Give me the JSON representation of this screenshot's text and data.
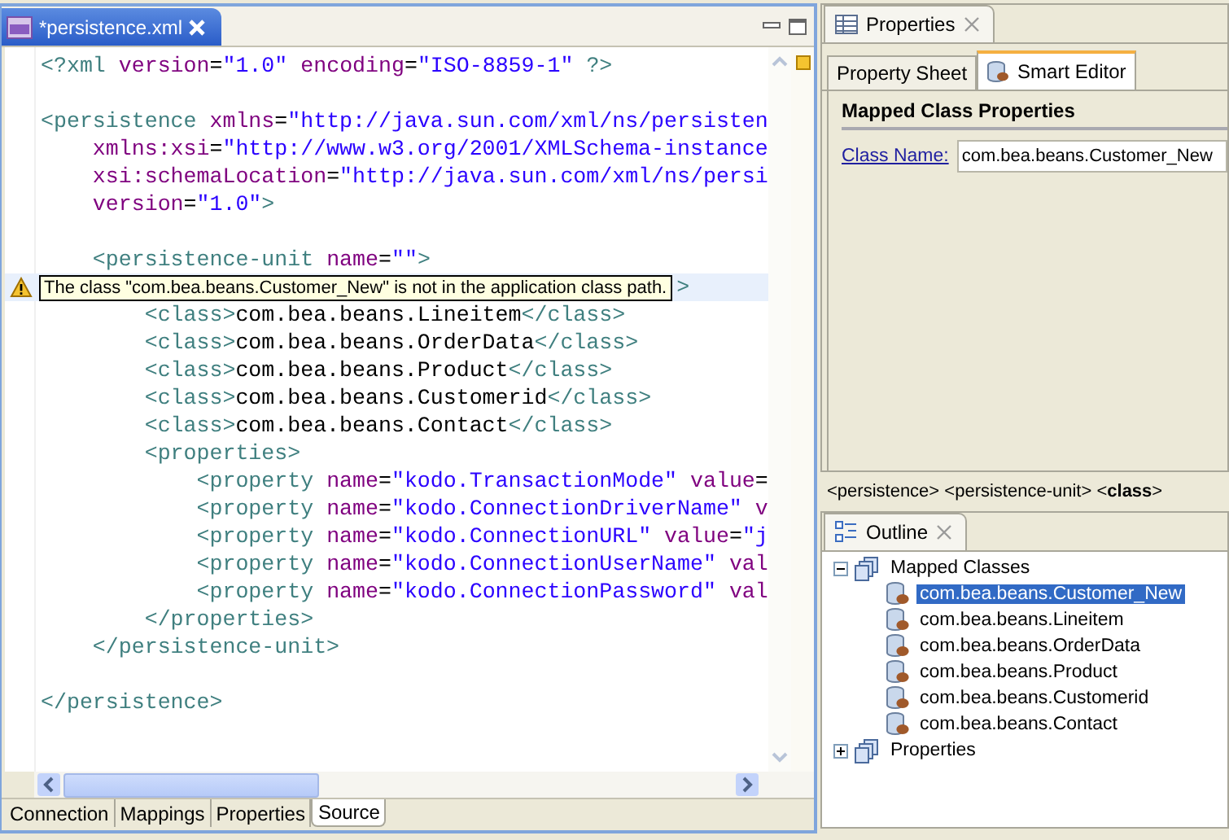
{
  "editor": {
    "tab": {
      "title": "*persistence.xml"
    },
    "lines": [
      {
        "kind": "code",
        "tokens": [
          {
            "kind": "tag",
            "t": "<?xml "
          },
          {
            "kind": "attr",
            "t": "version"
          },
          {
            "kind": "text",
            "t": "="
          },
          {
            "kind": "value",
            "t": "\"1.0\" "
          },
          {
            "kind": "attr",
            "t": "encoding"
          },
          {
            "kind": "text",
            "t": "="
          },
          {
            "kind": "value",
            "t": "\"ISO-8859-1\" "
          },
          {
            "kind": "tag",
            "t": "?>"
          }
        ]
      },
      {
        "kind": "blank"
      },
      {
        "kind": "code",
        "tokens": [
          {
            "kind": "tag",
            "t": "<persistence "
          },
          {
            "kind": "attr",
            "t": "xmlns"
          },
          {
            "kind": "text",
            "t": "="
          },
          {
            "kind": "value",
            "t": "\"http://java.sun.com/xml/ns/persisten"
          }
        ]
      },
      {
        "kind": "code",
        "tokens": [
          {
            "kind": "attr",
            "t": "    xmlns:xsi"
          },
          {
            "kind": "text",
            "t": "="
          },
          {
            "kind": "value",
            "t": "\"http://www.w3.org/2001/XMLSchema-instance"
          }
        ]
      },
      {
        "kind": "code",
        "tokens": [
          {
            "kind": "attr",
            "t": "    xsi:schemaLocation"
          },
          {
            "kind": "text",
            "t": "="
          },
          {
            "kind": "value",
            "t": "\"http://java.sun.com/xml/ns/persi"
          }
        ]
      },
      {
        "kind": "code",
        "tokens": [
          {
            "kind": "attr",
            "t": "    version"
          },
          {
            "kind": "text",
            "t": "="
          },
          {
            "kind": "value",
            "t": "\"1.0\""
          },
          {
            "kind": "tag",
            "t": ">"
          }
        ]
      },
      {
        "kind": "blank"
      },
      {
        "kind": "code",
        "tokens": [
          {
            "kind": "tag",
            "t": "    <persistence-unit "
          },
          {
            "kind": "attr",
            "t": "name"
          },
          {
            "kind": "text",
            "t": "="
          },
          {
            "kind": "value",
            "t": "\"\""
          },
          {
            "kind": "tag",
            "t": ">"
          }
        ]
      },
      {
        "kind": "warning",
        "tooltip": "The class \"com.bea.beans.Customer_New\" is not in the application class path.",
        "tokens": [
          {
            "kind": "tag",
            "t": ">"
          }
        ]
      },
      {
        "kind": "code",
        "tokens": [
          {
            "kind": "tag",
            "t": "        <class>"
          },
          {
            "kind": "text",
            "t": "com.bea.beans.Lineitem"
          },
          {
            "kind": "tag",
            "t": "</class>"
          }
        ]
      },
      {
        "kind": "code",
        "tokens": [
          {
            "kind": "tag",
            "t": "        <class>"
          },
          {
            "kind": "text",
            "t": "com.bea.beans.OrderData"
          },
          {
            "kind": "tag",
            "t": "</class>"
          }
        ]
      },
      {
        "kind": "code",
        "tokens": [
          {
            "kind": "tag",
            "t": "        <class>"
          },
          {
            "kind": "text",
            "t": "com.bea.beans.Product"
          },
          {
            "kind": "tag",
            "t": "</class>"
          }
        ]
      },
      {
        "kind": "code",
        "tokens": [
          {
            "kind": "tag",
            "t": "        <class>"
          },
          {
            "kind": "text",
            "t": "com.bea.beans.Customerid"
          },
          {
            "kind": "tag",
            "t": "</class>"
          }
        ]
      },
      {
        "kind": "code",
        "tokens": [
          {
            "kind": "tag",
            "t": "        <class>"
          },
          {
            "kind": "text",
            "t": "com.bea.beans.Contact"
          },
          {
            "kind": "tag",
            "t": "</class>"
          }
        ]
      },
      {
        "kind": "code",
        "tokens": [
          {
            "kind": "tag",
            "t": "        <properties>"
          }
        ]
      },
      {
        "kind": "code",
        "tokens": [
          {
            "kind": "tag",
            "t": "            <property "
          },
          {
            "kind": "attr",
            "t": "name"
          },
          {
            "kind": "text",
            "t": "="
          },
          {
            "kind": "value",
            "t": "\"kodo.TransactionMode\" "
          },
          {
            "kind": "attr",
            "t": "value"
          },
          {
            "kind": "text",
            "t": "="
          }
        ]
      },
      {
        "kind": "code",
        "tokens": [
          {
            "kind": "tag",
            "t": "            <property "
          },
          {
            "kind": "attr",
            "t": "name"
          },
          {
            "kind": "text",
            "t": "="
          },
          {
            "kind": "value",
            "t": "\"kodo.ConnectionDriverName\" "
          },
          {
            "kind": "attr",
            "t": "v"
          }
        ]
      },
      {
        "kind": "code",
        "tokens": [
          {
            "kind": "tag",
            "t": "            <property "
          },
          {
            "kind": "attr",
            "t": "name"
          },
          {
            "kind": "text",
            "t": "="
          },
          {
            "kind": "value",
            "t": "\"kodo.ConnectionURL\" "
          },
          {
            "kind": "attr",
            "t": "value"
          },
          {
            "kind": "text",
            "t": "="
          },
          {
            "kind": "value",
            "t": "\"j"
          }
        ]
      },
      {
        "kind": "code",
        "tokens": [
          {
            "kind": "tag",
            "t": "            <property "
          },
          {
            "kind": "attr",
            "t": "name"
          },
          {
            "kind": "text",
            "t": "="
          },
          {
            "kind": "value",
            "t": "\"kodo.ConnectionUserName\" "
          },
          {
            "kind": "attr",
            "t": "val"
          }
        ]
      },
      {
        "kind": "code",
        "tokens": [
          {
            "kind": "tag",
            "t": "            <property "
          },
          {
            "kind": "attr",
            "t": "name"
          },
          {
            "kind": "text",
            "t": "="
          },
          {
            "kind": "value",
            "t": "\"kodo.ConnectionPassword\" "
          },
          {
            "kind": "attr",
            "t": "val"
          }
        ]
      },
      {
        "kind": "code",
        "tokens": [
          {
            "kind": "tag",
            "t": "        </properties>"
          }
        ]
      },
      {
        "kind": "code",
        "tokens": [
          {
            "kind": "tag",
            "t": "    </persistence-unit>"
          }
        ]
      },
      {
        "kind": "blank"
      },
      {
        "kind": "code",
        "tokens": [
          {
            "kind": "tag",
            "t": "</persistence>"
          }
        ]
      }
    ],
    "bottom_tabs": [
      {
        "label": "Connection",
        "selected": false
      },
      {
        "label": "Mappings",
        "selected": false
      },
      {
        "label": "Properties",
        "selected": false
      },
      {
        "label": "Source",
        "selected": true
      }
    ]
  },
  "properties_view": {
    "title": "Properties",
    "tabs": [
      {
        "label": "Property Sheet",
        "selected": false
      },
      {
        "label": "Smart Editor",
        "selected": true
      }
    ],
    "section": "Mapped Class Properties",
    "field_label": "Class Name:",
    "field_value": "com.bea.beans.Customer_New"
  },
  "breadcrumb": "<persistence> <persistence-unit> <**class**>",
  "outline": {
    "title": "Outline",
    "tree": [
      {
        "label": "Mapped Classes",
        "expanded": true,
        "children": [
          {
            "label": "com.bea.beans.Customer_New",
            "selected": true
          },
          {
            "label": "com.bea.beans.Lineitem",
            "selected": false
          },
          {
            "label": "com.bea.beans.OrderData",
            "selected": false
          },
          {
            "label": "com.bea.beans.Product",
            "selected": false
          },
          {
            "label": "com.bea.beans.Customerid",
            "selected": false
          },
          {
            "label": "com.bea.beans.Contact",
            "selected": false
          }
        ]
      },
      {
        "label": "Properties",
        "expanded": false
      }
    ]
  }
}
